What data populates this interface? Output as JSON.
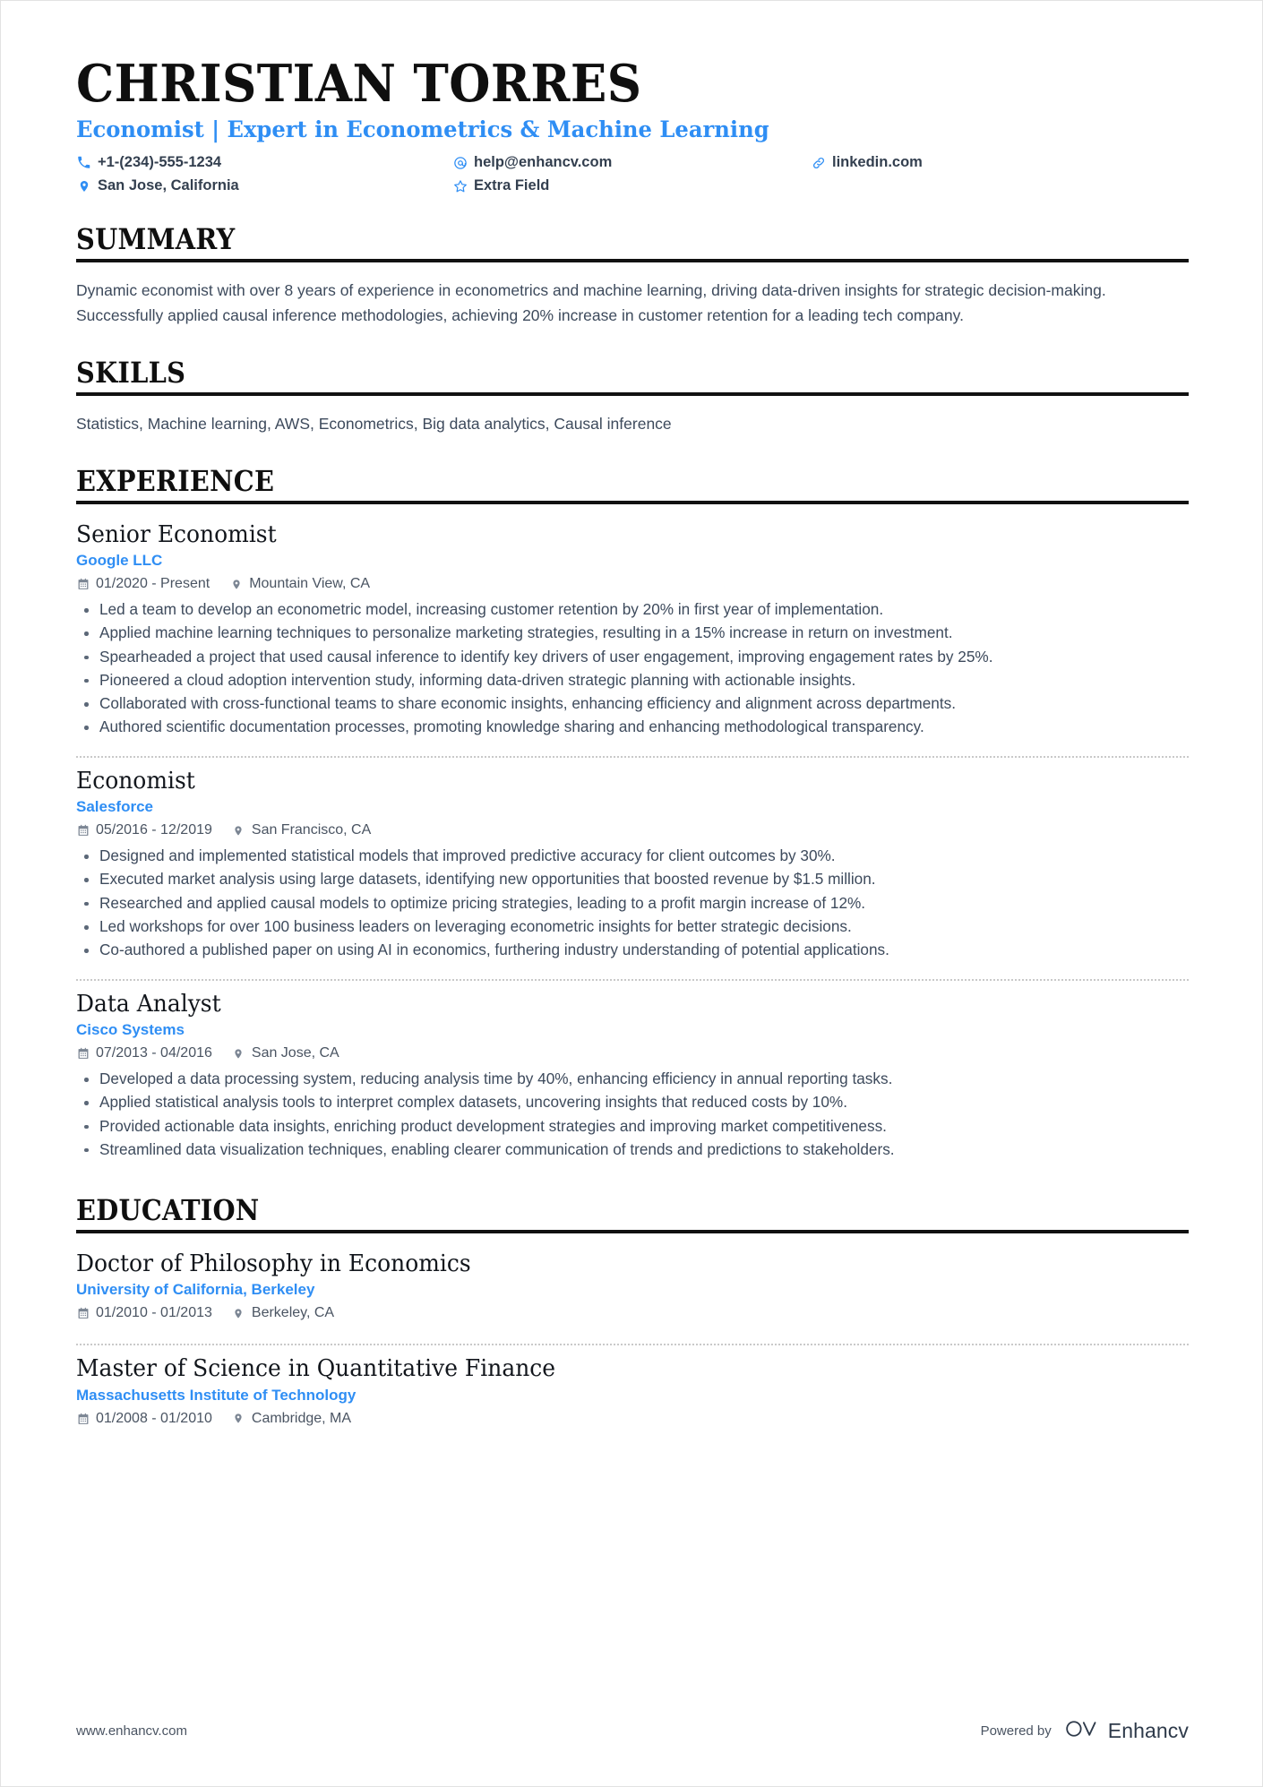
{
  "header": {
    "name": "CHRISTIAN TORRES",
    "subtitle": "Economist | Expert in Econometrics & Machine Learning",
    "contacts": [
      {
        "icon": "phone-icon",
        "text": "+1-(234)-555-1234"
      },
      {
        "icon": "email-icon",
        "text": "help@enhancv.com"
      },
      {
        "icon": "link-icon",
        "text": "linkedin.com"
      },
      {
        "icon": "location-pin-icon",
        "text": "San Jose, California"
      },
      {
        "icon": "star-icon",
        "text": "Extra Field"
      }
    ]
  },
  "sections": {
    "summary": {
      "title": "SUMMARY",
      "text": "Dynamic economist with over 8 years of experience in econometrics and machine learning, driving data-driven insights for strategic decision-making. Successfully applied causal inference methodologies, achieving 20% increase in customer retention for a leading tech company."
    },
    "skills": {
      "title": "SKILLS",
      "text": "Statistics, Machine learning, AWS, Econometrics, Big data analytics, Causal inference"
    },
    "experience": {
      "title": "EXPERIENCE",
      "entries": [
        {
          "title": "Senior Economist",
          "org": "Google LLC",
          "dates": "01/2020 - Present",
          "location": "Mountain View, CA",
          "bullets": [
            "Led a team to develop an econometric model, increasing customer retention by 20% in first year of implementation.",
            "Applied machine learning techniques to personalize marketing strategies, resulting in a 15% increase in return on investment.",
            "Spearheaded a project that used causal inference to identify key drivers of user engagement, improving engagement rates by 25%.",
            "Pioneered a cloud adoption intervention study, informing data-driven strategic planning with actionable insights.",
            "Collaborated with cross-functional teams to share economic insights, enhancing efficiency and alignment across departments.",
            "Authored scientific documentation processes, promoting knowledge sharing and enhancing methodological transparency."
          ]
        },
        {
          "title": "Economist",
          "org": "Salesforce",
          "dates": "05/2016 - 12/2019",
          "location": "San Francisco, CA",
          "bullets": [
            "Designed and implemented statistical models that improved predictive accuracy for client outcomes by 30%.",
            "Executed market analysis using large datasets, identifying new opportunities that boosted revenue by $1.5 million.",
            "Researched and applied causal models to optimize pricing strategies, leading to a profit margin increase of 12%.",
            "Led workshops for over 100 business leaders on leveraging econometric insights for better strategic decisions.",
            "Co-authored a published paper on using AI in economics, furthering industry understanding of potential applications."
          ]
        },
        {
          "title": "Data Analyst",
          "org": "Cisco Systems",
          "dates": "07/2013 - 04/2016",
          "location": "San Jose, CA",
          "bullets": [
            "Developed a data processing system, reducing analysis time by 40%, enhancing efficiency in annual reporting tasks.",
            "Applied statistical analysis tools to interpret complex datasets, uncovering insights that reduced costs by 10%.",
            "Provided actionable data insights, enriching product development strategies and improving market competitiveness.",
            "Streamlined data visualization techniques, enabling clearer communication of trends and predictions to stakeholders."
          ]
        }
      ]
    },
    "education": {
      "title": "EDUCATION",
      "entries": [
        {
          "title": "Doctor of Philosophy in Economics",
          "org": "University of California, Berkeley",
          "dates": "01/2010 - 01/2013",
          "location": "Berkeley, CA"
        },
        {
          "title": "Master of Science in Quantitative Finance",
          "org": "Massachusetts Institute of Technology",
          "dates": "01/2008 - 01/2010",
          "location": "Cambridge, MA"
        }
      ]
    }
  },
  "footer": {
    "url": "www.enhancv.com",
    "powered_by": "Powered by",
    "brand": "Enhancv"
  },
  "colors": {
    "accent": "#2f8ef4",
    "text": "#3d4a5c",
    "heading": "#0f0f0f",
    "rule": "#111111",
    "meta_icon": "#7b8593"
  }
}
